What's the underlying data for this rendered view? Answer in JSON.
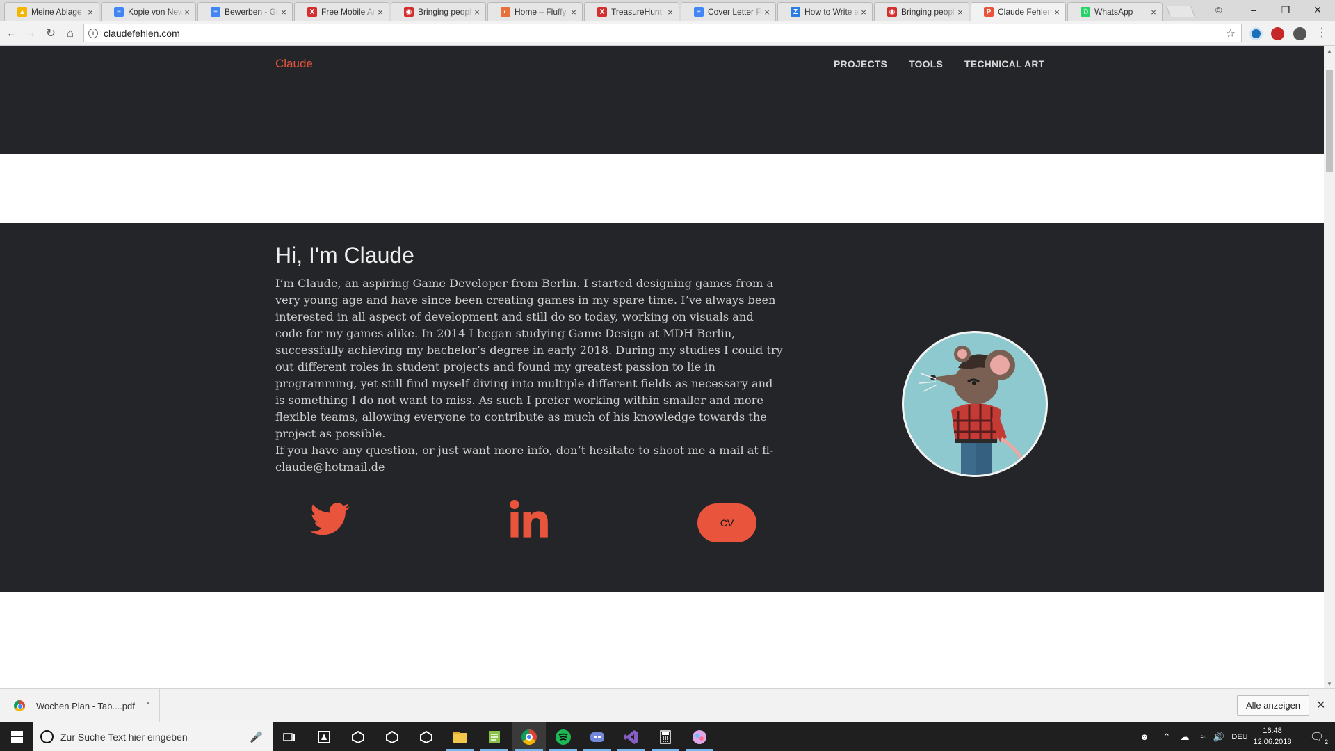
{
  "browser": {
    "tabs": [
      {
        "title": "Meine Ablage",
        "favicon": "google-drive-icon",
        "color": "#f4b400"
      },
      {
        "title": "Kopie von New",
        "favicon": "google-docs-icon",
        "color": "#4285f4"
      },
      {
        "title": "Bewerben - Go",
        "favicon": "google-docs-icon",
        "color": "#4285f4"
      },
      {
        "title": "Free Mobile Ar",
        "favicon": "x-icon",
        "color": "#d32f2f"
      },
      {
        "title": "Bringing peopl",
        "favicon": "red-circle-icon",
        "color": "#d32f2f"
      },
      {
        "title": "Home – Fluffy",
        "favicon": "orange-swirl-icon",
        "color": "#e8703a"
      },
      {
        "title": "TreasureHunt",
        "favicon": "x-icon",
        "color": "#d32f2f"
      },
      {
        "title": "Cover Letter Fi",
        "favicon": "google-docs-icon",
        "color": "#4285f4"
      },
      {
        "title": "How to Write a",
        "favicon": "z-icon",
        "color": "#2a7de1"
      },
      {
        "title": "Bringing peopl",
        "favicon": "red-circle-icon",
        "color": "#d32f2f"
      },
      {
        "title": "Claude Fehlen",
        "favicon": "p-icon",
        "color": "#e8543c"
      },
      {
        "title": "WhatsApp",
        "favicon": "whatsapp-icon",
        "color": "#25d366"
      }
    ],
    "active_tab": "Claude Fehlen",
    "url": "claudefehlen.com"
  },
  "site": {
    "brand": "Claude",
    "nav": [
      "PROJECTS",
      "TOOLS",
      "TECHNICAL ART"
    ],
    "heading": "Hi, I'm Claude",
    "bio": "I’m Claude, an aspiring Game Developer from Berlin. I started designing games from a very young age and have since been creating games in my spare time. I’ve always been interested in all aspect of development and still do so today, working on visuals and code for my games alike. In 2014 I began studying Game Design at MDH Berlin, successfully achieving my bachelor’s degree in early 2018. During my studies I could try out different roles in student projects and found my greatest passion to lie in programming, yet still find myself diving into multiple different fields as necessary and is something I do not want to miss. As such I prefer working within smaller and more flexible teams, allowing everyone to contribute as much of his knowledge towards the project as possible.",
    "contact": "If you have any question, or just want more info, don’t hesitate to shoot me a mail at fl-claude@hotmail.de",
    "social": {
      "twitter": "twitter-icon",
      "linkedin": "linkedin-icon",
      "cv_label": "CV"
    },
    "accent_color": "#e8543c",
    "dark_bg": "#232528"
  },
  "downloads": {
    "file": "Wochen Plan - Tab....pdf",
    "show_all": "Alle anzeigen"
  },
  "taskbar": {
    "search_placeholder": "Zur Suche Text hier eingeben",
    "language": "DEU",
    "time": "16:48",
    "date": "12.06.2018",
    "notifications": "2"
  }
}
